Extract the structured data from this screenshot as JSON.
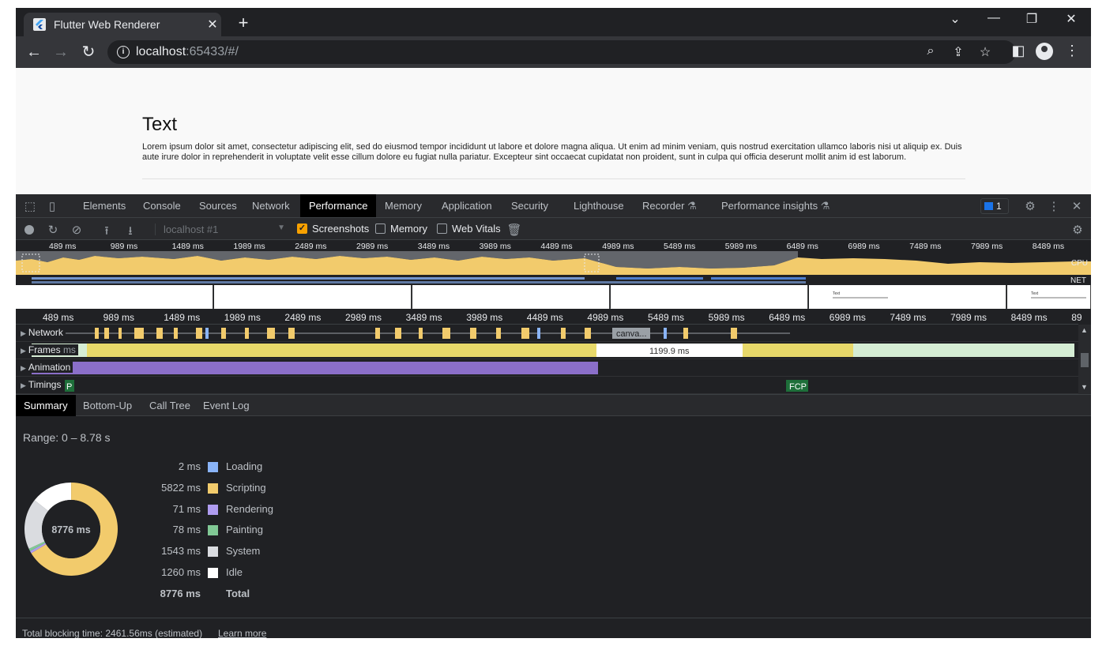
{
  "browser": {
    "tab_title": "Flutter Web Renderer",
    "tab_close": "✕",
    "new_tab": "+",
    "url_host": "localhost",
    "url_rest": ":65433/#/"
  },
  "webpage": {
    "heading": "Text",
    "paragraph": "Lorem ipsum dolor sit amet, consectetur adipiscing elit, sed do eiusmod tempor incididunt ut labore et dolore magna aliqua. Ut enim ad minim veniam, quis nostrud exercitation ullamco laboris nisi ut aliquip ex. Duis aute irure dolor in reprehenderit in voluptate velit esse cillum dolore eu fugiat nulla pariatur. Excepteur sint occaecat cupidatat non proident, sunt in culpa qui officia deserunt mollit anim id est laborum."
  },
  "devtools": {
    "tabs": [
      "Elements",
      "Console",
      "Sources",
      "Network",
      "Performance",
      "Memory",
      "Application",
      "Security",
      "Lighthouse",
      "Recorder",
      "Performance insights"
    ],
    "active_tab": "Performance",
    "issues_count": "1",
    "profile_select": "localhost #1",
    "checkboxes": {
      "screenshots": {
        "label": "Screenshots",
        "checked": true
      },
      "memory": {
        "label": "Memory",
        "checked": false
      },
      "web_vitals": {
        "label": "Web Vitals",
        "checked": false
      }
    },
    "overview_ticks": [
      "489 ms",
      "989 ms",
      "1489 ms",
      "1989 ms",
      "2489 ms",
      "2989 ms",
      "3489 ms",
      "3989 ms",
      "4489 ms",
      "4989 ms",
      "5489 ms",
      "5989 ms",
      "6489 ms",
      "6989 ms",
      "7489 ms",
      "7989 ms",
      "8489 ms"
    ],
    "overview_labels": {
      "cpu": "CPU",
      "net": "NET"
    },
    "screenshot_text": "Text",
    "timeline_ticks": [
      "489 ms",
      "989 ms",
      "1489 ms",
      "1989 ms",
      "2489 ms",
      "2989 ms",
      "3489 ms",
      "3989 ms",
      "4489 ms",
      "4989 ms",
      "5489 ms",
      "5989 ms",
      "6489 ms",
      "6989 ms",
      "7489 ms",
      "7989 ms",
      "8489 ms",
      "89"
    ],
    "tracks": {
      "network": "Network",
      "frames": "Frames",
      "animation": "Animation",
      "timings": "Timings"
    },
    "frames_prefix": "ms",
    "network_canvas": "canva...",
    "frame_duration": "1199.9 ms",
    "timing_marker_p": "P",
    "timing_marker_fcp": "FCP",
    "bottom_tabs": [
      "Summary",
      "Bottom-Up",
      "Call Tree",
      "Event Log"
    ],
    "active_bottom_tab": "Summary",
    "range": "Range: 0 – 8.78 s",
    "summary": {
      "total_label": "8776 ms",
      "rows": [
        {
          "value": "2 ms",
          "name": "Loading",
          "color": "#8ab4f8",
          "ms": 2
        },
        {
          "value": "5822 ms",
          "name": "Scripting",
          "color": "#f2cb6c",
          "ms": 5822
        },
        {
          "value": "71 ms",
          "name": "Rendering",
          "color": "#af9cf0",
          "ms": 71
        },
        {
          "value": "78 ms",
          "name": "Painting",
          "color": "#81c995",
          "ms": 78
        },
        {
          "value": "1543 ms",
          "name": "System",
          "color": "#dadce0",
          "ms": 1543
        },
        {
          "value": "1260 ms",
          "name": "Idle",
          "color": "#ffffff",
          "ms": 1260
        }
      ],
      "total_row": {
        "value": "8776 ms",
        "name": "Total"
      }
    },
    "footer": {
      "text": "Total blocking time: 2461.56ms (estimated)",
      "link": "Learn more"
    }
  }
}
